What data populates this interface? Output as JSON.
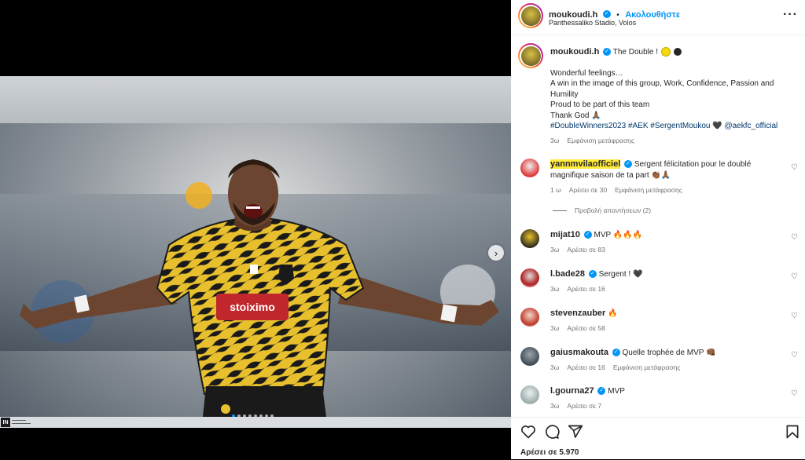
{
  "post": {
    "author": "moukoudi.h",
    "follow_label": "Ακολουθήστε",
    "separator": "•",
    "location": "Panthessaliko Stadio, Volos",
    "more_label": "···",
    "next_label": "›"
  },
  "strip": {
    "logo_text": "IN"
  },
  "caption": {
    "author": "moukoudi.h",
    "title": "The Double !",
    "lines": [
      "Wonderful feelings…",
      "A win in the image of this group, Work, Confidence, Passion and Humility",
      "Proud to be part of this team",
      "Thank God 🙏🏾"
    ],
    "tags": "#DoubleWinners2023 #AEK #SergentMoukou 🖤 @aekfc_official",
    "time": "3ω",
    "translate_label": "Εμφάνιση μετάφρασης",
    "emoji_colors": [
      "#f5d90a",
      "#262626"
    ]
  },
  "comments": [
    {
      "user": "yannmvilaofficiel",
      "text": "Sergent félicitation pour le doublé magnifique saison de ta part 👏🏾🙏🏾",
      "time": "1 ω",
      "likes": "Αρέσει σε 30",
      "translate": "Εμφάνιση μετάφρασης"
    },
    {
      "user": "mijat10",
      "text": "MVP 🔥🔥🔥",
      "time": "3ω",
      "likes": "Αρέσει σε 83"
    },
    {
      "user": "l.bade28",
      "text": "Sergent ! 🖤",
      "time": "3ω",
      "likes": "Αρέσει σε 16"
    },
    {
      "user": "stevenzauber",
      "text": "🔥",
      "time": "3ω",
      "likes": "Αρέσει σε 58"
    },
    {
      "user": "gaiusmakouta",
      "text": "Quelle trophée de MVP 👊🏾",
      "time": "3ω",
      "likes": "Αρέσει σε 16",
      "translate": "Εμφάνιση μετάφρασης"
    },
    {
      "user": "l.gourna27",
      "text": "MVP",
      "time": "3ω",
      "likes": "Αρέσει σε 7"
    }
  ],
  "view_replies": "Προβολή απαντήσεων (2)",
  "likes_total": "Αρέσει σε 5.970",
  "icons": [
    "heart-icon",
    "comment-icon",
    "share-icon",
    "bookmark-icon",
    "verified-icon",
    "more-icon"
  ],
  "colors": {
    "accent": "#0095f6",
    "aek_yellow": "#e8c02e",
    "highlight": "#ffeb3b"
  }
}
